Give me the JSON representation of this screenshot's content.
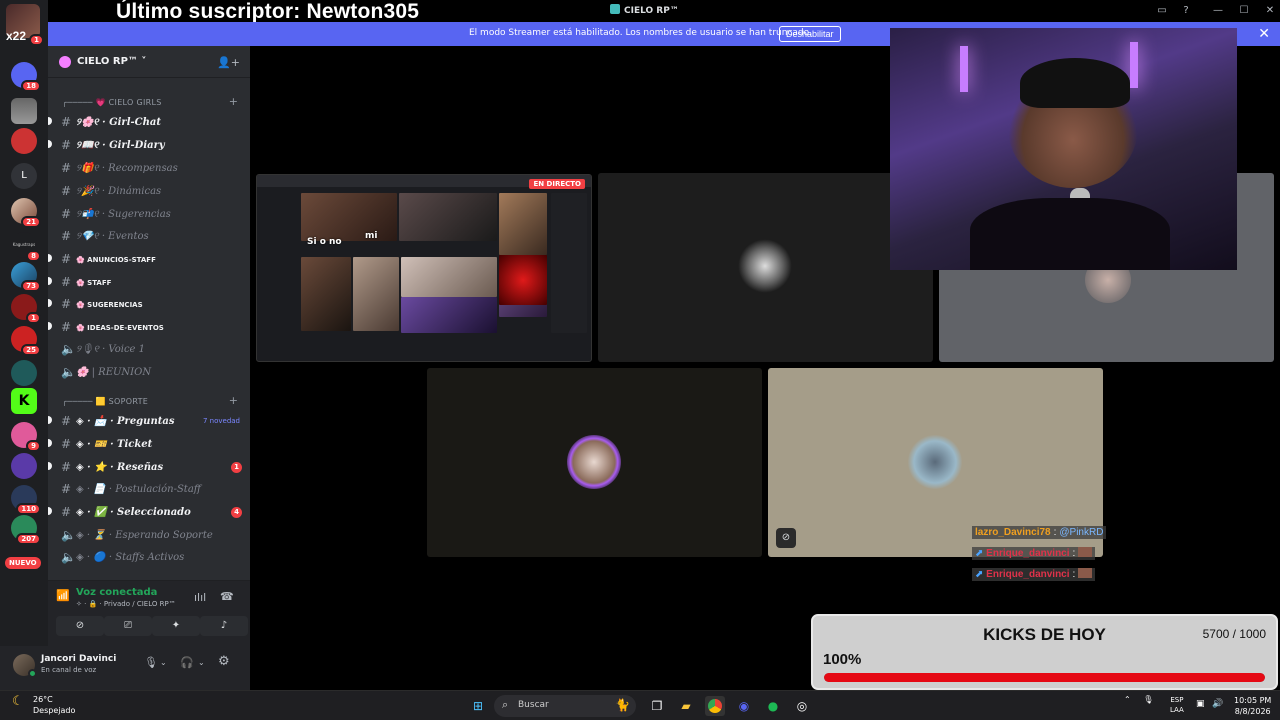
{
  "overlay": {
    "subscriber_banner": "Último suscriptor: Newton305"
  },
  "window": {
    "title": "CIELO RP™",
    "inbox_icon": "inbox-icon",
    "help_icon": "help-icon"
  },
  "notice": {
    "text": "El modo Streamer está habilitado. Los nombres de usuario se han truncado.",
    "button": "Deshabilitar"
  },
  "rail": {
    "top_label": "x22",
    "badges": [
      "1",
      "18",
      "21",
      "8",
      "73",
      "1",
      "25",
      "9",
      "110",
      "207"
    ],
    "letter_server": "L",
    "small_server_label": "Kagustraps",
    "nuevo": "NUEVO"
  },
  "guild": {
    "name": "CIELO RP™"
  },
  "categories": [
    {
      "label": "╭───── 💗 CIELO GIRLS"
    },
    {
      "label": "╭───── 🟨 SOPORTE"
    }
  ],
  "channels": [
    {
      "label": "୨🌸୧ · Girl-Chat",
      "state": "unread"
    },
    {
      "label": "୨📖୧ · Girl-Diary",
      "state": "unread"
    },
    {
      "label": "୨🎁୧ · Recompensas",
      "state": "read"
    },
    {
      "label": "୨🎉୧ · Dinámicas",
      "state": "read"
    },
    {
      "label": "୨📬୧ · Sugerencias",
      "state": "read"
    },
    {
      "label": "୨💎୧ · Eventos",
      "state": "read"
    },
    {
      "label": "🌸 ANUNCIOS-STAFF",
      "state": "unread"
    },
    {
      "label": "🌸 STAFF",
      "state": "unread"
    },
    {
      "label": "🌸 SUGERENCIAS",
      "state": "unread"
    },
    {
      "label": "🌸 IDEAS-DE-EVENTOS",
      "state": "unread"
    },
    {
      "label": "୨🎙୧ · Voice 1",
      "state": "read"
    },
    {
      "label": "🌸 | REUNION",
      "state": "read"
    },
    {
      "label": "◈ · 📩 · Preguntas",
      "state": "unread",
      "tag": "7 novedad"
    },
    {
      "label": "◈ · 🎫 · Ticket",
      "state": "unread"
    },
    {
      "label": "◈ · ⭐ · Reseñas",
      "state": "unread",
      "badge": "1"
    },
    {
      "label": "◈ · 📄 · Postulación-Staff",
      "state": "read"
    },
    {
      "label": "◈ · ✅ · Seleccionado",
      "state": "unread",
      "badge": "4"
    },
    {
      "label": "◈ · ⏳ · Esperando Soporte",
      "state": "read"
    },
    {
      "label": "◈ · 🔵 · Staffs Activos",
      "state": "read"
    }
  ],
  "voice_panel": {
    "status": "Voz conectada",
    "location": "✧ · 🔒 · Privado / CIELO RP™"
  },
  "user": {
    "name": "Jancori Davinci",
    "status": "En canal de voz"
  },
  "stage": {
    "live_badge": "EN DIRECTO",
    "screen_caption_left": "Si o no",
    "screen_caption_mid": "mi"
  },
  "chat": [
    {
      "user": "lazro_Davinci78",
      "sep": ":",
      "msg": "@PinkRD",
      "user_color": "#f0a020",
      "msg_color": "#7ab7ff"
    },
    {
      "user": "Enrique_danvinci",
      "sep": ":",
      "msg": "",
      "user_color": "#e0324a",
      "msg_color": "#ffffff"
    },
    {
      "user": "Enrique_danvinci",
      "sep": ":",
      "msg": "",
      "user_color": "#e0324a",
      "msg_color": "#ffffff"
    }
  ],
  "goal": {
    "title": "KICKS DE HOY",
    "count": "5700 / 1000",
    "percent": "100%",
    "fill_fraction": 1.0
  },
  "taskbar": {
    "weather_temp": "26°C",
    "weather_text": "Despejado",
    "search_placeholder": "Buscar",
    "lang_top": "ESP",
    "lang_bottom": "LAA",
    "time": "10:05 PM",
    "date": "8/8/2026"
  },
  "colors": {
    "blurple": "#5865f2",
    "green": "#23a55a",
    "red": "#f23f43",
    "goal_fill": "#e50914"
  }
}
